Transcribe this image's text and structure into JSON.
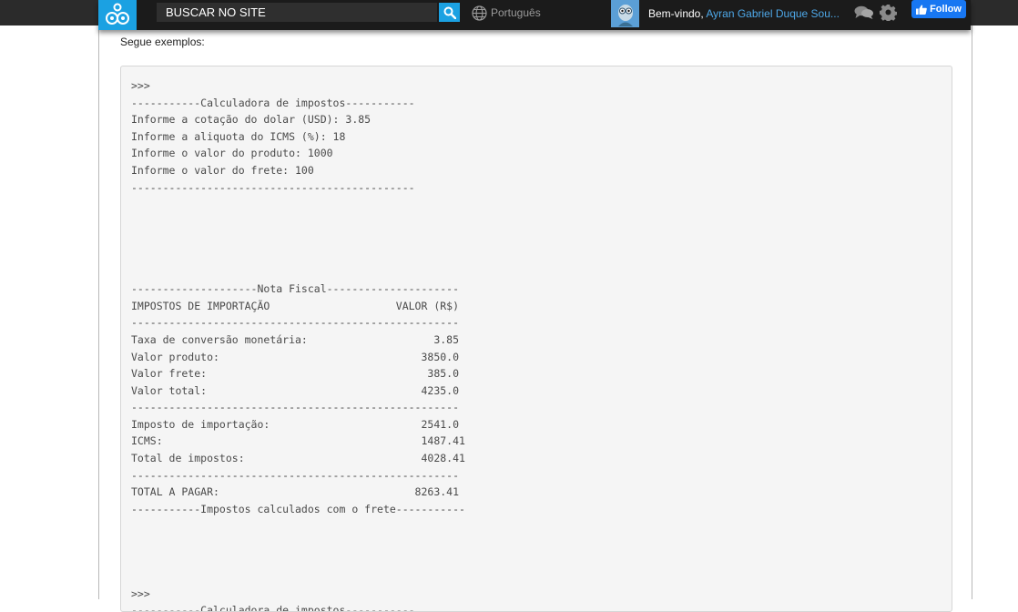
{
  "header": {
    "search_placeholder": "BUSCAR NO SITE",
    "language": "Português",
    "welcome": "Bem-vindo,",
    "user_name": "Ayran Gabriel Duque Sou...",
    "follow_label": "Follow",
    "colors": {
      "accent": "#1ba1e2",
      "bar": "#1b1b1b",
      "link": "#4ea8e8",
      "facebook": "#1877f2"
    }
  },
  "content": {
    "intro": "Segue exemplos:",
    "code_lines": [
      ">>>",
      "-----------Calculadora de impostos-----------",
      "Informe a cotação do dolar (USD): 3.85",
      "Informe a aliquota do ICMS (%): 18",
      "Informe o valor do produto: 1000",
      "Informe o valor do frete: 100",
      "---------------------------------------------",
      "",
      "",
      "",
      "",
      "",
      "--------------------Nota Fiscal---------------------",
      "IMPOSTOS DE IMPORTAÇÃO                    VALOR (R$)",
      "----------------------------------------------------",
      "Taxa de conversão monetária:                    3.85",
      "Valor produto:                                3850.0",
      "Valor frete:                                   385.0",
      "Valor total:                                  4235.0",
      "----------------------------------------------------",
      "Imposto de importação:                        2541.0",
      "ICMS:                                         1487.41",
      "Total de impostos:                            4028.41",
      "----------------------------------------------------",
      "TOTAL A PAGAR:                               8263.41",
      "-----------Impostos calculados com o frete-----------",
      "",
      "",
      "",
      "",
      ">>>",
      "-----------Calculadora de impostos-----------"
    ]
  }
}
